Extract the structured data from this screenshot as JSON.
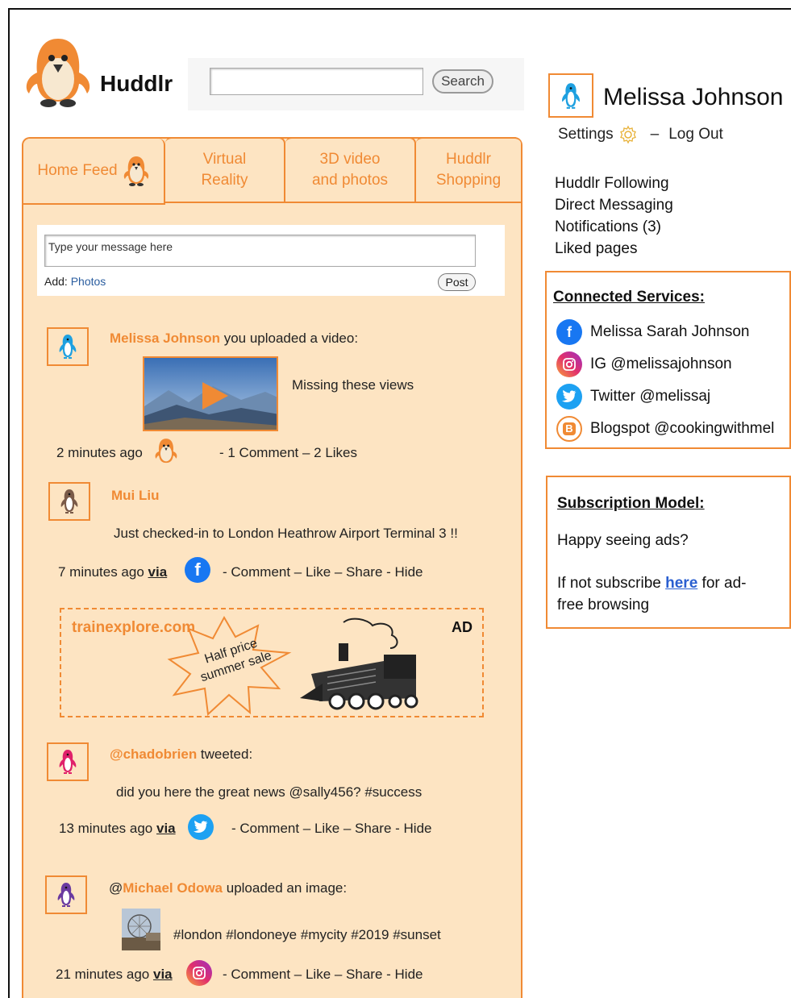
{
  "header": {
    "brand": "Huddlr",
    "search_placeholder": "",
    "search_button": "Search"
  },
  "tabs": [
    {
      "label": "Home Feed"
    },
    {
      "label_line1": "Virtual",
      "label_line2": "Reality"
    },
    {
      "label_line1": "3D video",
      "label_line2": "and photos"
    },
    {
      "label_line1": "Huddlr",
      "label_line2": "Shopping"
    }
  ],
  "composer": {
    "placeholder": "Type your message here",
    "add_label": "Add:",
    "photos_link": "Photos",
    "post_button": "Post"
  },
  "posts": [
    {
      "author": "Melissa Johnson",
      "action": " you uploaded a video:",
      "caption": "Missing these views",
      "time": "2 minutes ago",
      "stats": "- 1 Comment – 2 Likes"
    },
    {
      "author": "Mui Liu",
      "body": "Just checked-in to London Heathrow Airport Terminal 3 !!",
      "time": "7 minutes ago",
      "via": "via",
      "actions": "- Comment – Like – Share - Hide"
    },
    {
      "author": "@chadobrien",
      "action": " tweeted:",
      "body": "did you here the great news @sally456? #success",
      "time": "13 minutes ago",
      "via": "via",
      "actions": "- Comment – Like – Share - Hide"
    },
    {
      "prefix": "@",
      "author": "Michael Odowa",
      "action": " uploaded an image:",
      "body": "#london #londoneye #mycity #2019 #sunset",
      "time": "21 minutes ago",
      "via": "via",
      "actions": "- Comment – Like – Share - Hide"
    }
  ],
  "ad": {
    "site": "trainexplore.com",
    "label": "AD",
    "promo_line1": "Half price",
    "promo_line2": "summer sale"
  },
  "profile": {
    "name": "Melissa Johnson",
    "settings": "Settings",
    "separator": "–",
    "logout": "Log Out"
  },
  "menu": [
    "Huddlr Following",
    "Direct Messaging",
    "Notifications (3)",
    "Liked pages"
  ],
  "connected": {
    "title": "Connected Services:",
    "items": [
      {
        "label": "Melissa Sarah Johnson",
        "icon": "facebook-icon",
        "color": "#1877f2"
      },
      {
        "label": "IG @melissajohnson",
        "icon": "instagram-icon",
        "color": "#e1306c"
      },
      {
        "label": "Twitter @melissaj",
        "icon": "twitter-icon",
        "color": "#1da1f2"
      },
      {
        "label": "Blogspot @cookingwithmel",
        "icon": "blogger-icon",
        "color": "#f08a34"
      }
    ]
  },
  "subscription": {
    "title": "Subscription Model:",
    "line1": "Happy seeing ads?",
    "line2_pre": "If not subscribe ",
    "line2_link": "here",
    "line2_post": " for ad-",
    "line3": "free browsing"
  },
  "colors": {
    "accent": "#f08a34",
    "feed_bg": "#fde4c2",
    "link": "#2a5fd0"
  }
}
